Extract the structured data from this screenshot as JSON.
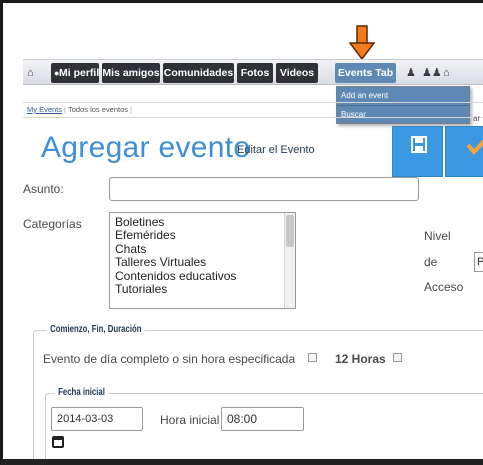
{
  "nav": {
    "home_icon": "home-icon",
    "tabs": [
      {
        "label": "Mi perfil",
        "icon": "person-icon"
      },
      {
        "label": "Mis amigos"
      },
      {
        "label": "Comunidades"
      },
      {
        "label": "Fotos"
      },
      {
        "label": "Videos"
      },
      {
        "label": "Events Tab"
      }
    ],
    "right_icons": [
      "bell-icon",
      "friends-icon",
      "home-outline-icon"
    ]
  },
  "events_menu": {
    "items": [
      "Add an event",
      "Buscar"
    ]
  },
  "sublinks": {
    "my_events": "My Events",
    "all_events": "Todos los eventos",
    "right_text": "ar"
  },
  "header": {
    "title": "Agregar evento",
    "edit_link": "Editar el Evento",
    "save_icon": "floppy-disk-icon",
    "confirm_icon": "checkmark-icon"
  },
  "form": {
    "asunto_label": "Asunto:",
    "asunto_value": "",
    "categorias_label": "Categorías",
    "categorias_options": [
      "Boletines",
      "Efemérides",
      "Chats",
      "Talleres Virtuales",
      "Contenidos educativos",
      "Tutoriales"
    ],
    "access": {
      "line1": "Nivel",
      "line2": "de",
      "line3": "Acceso",
      "select_value": "P"
    },
    "duration": {
      "legend": "Comienzo, Fin, Duración",
      "all_day_label": "Evento de día completo o sin hora especificada",
      "twelve_hours_label": "12 Horas"
    },
    "start": {
      "legend": "Fecha inicial",
      "date_value": "2014-03-03",
      "time_label": "Hora inicial",
      "time_value": "08:00",
      "calendar_icon": "calendar-icon"
    }
  },
  "colors": {
    "accent": "#3a99e0",
    "nav_tab": "#2e3136",
    "active_tab": "#5f89b5",
    "arrow": "#f47a20",
    "title": "#3f8ed9"
  }
}
